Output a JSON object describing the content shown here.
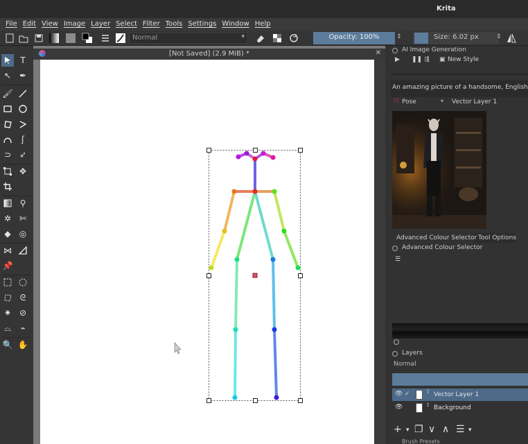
{
  "window": {
    "title": "Krita"
  },
  "menu": [
    "File",
    "Edit",
    "View",
    "Image",
    "Layer",
    "Select",
    "Filter",
    "Tools",
    "Settings",
    "Window",
    "Help"
  ],
  "toolbar": {
    "blend_mode": "Normal",
    "opacity": "Opacity: 100%",
    "size": "Size: 6.02 px",
    "accent_color": "#5d7c9c"
  },
  "document": {
    "tab_title": "[Not Saved]  (2.9 MiB) *",
    "close": "✕"
  },
  "ai_panel": {
    "title": "AI Image Generation",
    "style_button": "New Style",
    "prompt": "An amazing picture of a handsome, English, roden",
    "control_type": "Pose",
    "control_layer": "Vector Layer 1"
  },
  "color_panel": {
    "tabs": [
      "Advanced Colour Selector",
      "Tool Options"
    ],
    "title": "Advanced Colour Selector"
  },
  "layers_panel": {
    "title": "Layers",
    "blend_mode": "Normal",
    "layers": [
      {
        "name": "Vector Layer 1",
        "selected": true,
        "checked": true
      },
      {
        "name": "Background",
        "selected": false,
        "checked": false
      }
    ]
  },
  "brush_presets": {
    "title": "Brush Presets"
  }
}
